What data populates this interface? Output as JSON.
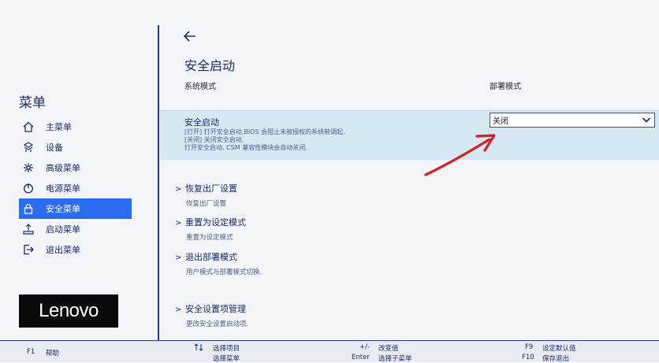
{
  "sidebar": {
    "title": "菜单",
    "items": [
      {
        "label": "主菜单",
        "icon": "home-icon"
      },
      {
        "label": "设备",
        "icon": "devices-icon"
      },
      {
        "label": "高级菜单",
        "icon": "advanced-icon"
      },
      {
        "label": "电源菜单",
        "icon": "power-icon"
      },
      {
        "label": "安全菜单",
        "icon": "lock-icon",
        "active": true
      },
      {
        "label": "启动菜单",
        "icon": "boot-icon"
      },
      {
        "label": "退出菜单",
        "icon": "exit-icon"
      }
    ],
    "logo": "Lenovo"
  },
  "main": {
    "title": "安全启动",
    "system_mode_label": "系统模式",
    "system_mode_value": "部署模式",
    "secure_boot": {
      "label": "安全启动",
      "desc1": "[打开] 打开安全启动,BIOS 会阻止未被授权的系统被调起.",
      "desc2": "[关闭] 关闭安全启动.",
      "desc3": "打开安全启动, CSM 兼容性模块会自动关闭.",
      "value": "关闭"
    },
    "links": [
      {
        "label": "恢复出厂设置",
        "desc": "恢复出厂设置"
      },
      {
        "label": "重置为设定模式",
        "desc": "重置为设定模式"
      },
      {
        "label": "退出部署模式",
        "desc": "用户模式与部署模式切换."
      },
      {
        "label": "安全设置项管理",
        "desc": "更改安全设置启动项."
      }
    ]
  },
  "footer": {
    "f1_key": "F1",
    "f1_label": "帮助",
    "arrows_label": "选择项目",
    "arrows_label2": "选择菜单",
    "plusminus_key": "+/-",
    "plusminus_label": "改变值",
    "enter_key": "Enter",
    "enter_label": "选择子菜单",
    "f9_key": "F9",
    "f9_label": "设定默认值",
    "f10_key": "F10",
    "f10_label": "保存退出"
  },
  "colors": {
    "accent": "#2b6cf0",
    "text": "#1c2b6b",
    "highlight_row": "#d6e8f2",
    "annotation_arrow": "#d0202a"
  }
}
